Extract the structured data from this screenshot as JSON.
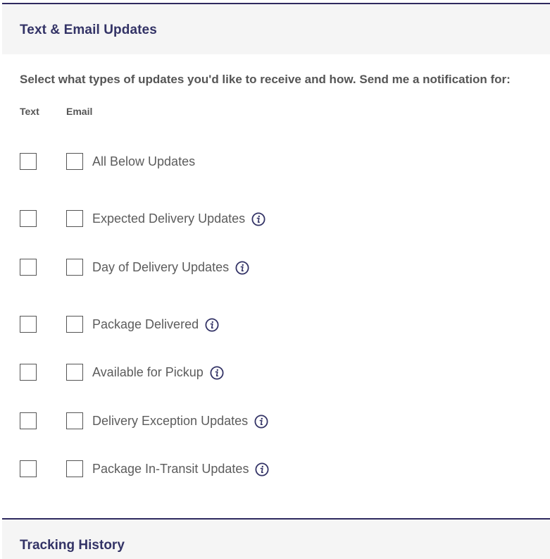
{
  "section": {
    "title": "Text & Email Updates",
    "intro": "Select what types of updates you'd like to receive and how. Send me a notification for:",
    "columns": {
      "text": "Text",
      "email": "Email"
    },
    "rows": [
      {
        "label": "All Below Updates",
        "info": false,
        "text_checked": false,
        "email_checked": false
      },
      {
        "label": "Expected Delivery Updates",
        "info": true,
        "text_checked": false,
        "email_checked": false
      },
      {
        "label": "Day of Delivery Updates",
        "info": true,
        "text_checked": false,
        "email_checked": false
      },
      {
        "label": "Package Delivered",
        "info": true,
        "text_checked": false,
        "email_checked": false
      },
      {
        "label": "Available for Pickup",
        "info": true,
        "text_checked": false,
        "email_checked": false
      },
      {
        "label": "Delivery Exception Updates",
        "info": true,
        "text_checked": false,
        "email_checked": false
      },
      {
        "label": "Package In-Transit Updates",
        "info": true,
        "text_checked": false,
        "email_checked": false
      }
    ]
  },
  "next_section": {
    "title": "Tracking History"
  },
  "colors": {
    "accent": "#333366",
    "rule": "#2f2a5f",
    "header_bg": "#f5f5f5",
    "text": "#555555"
  },
  "icons": {
    "info": "info-circle-icon"
  }
}
